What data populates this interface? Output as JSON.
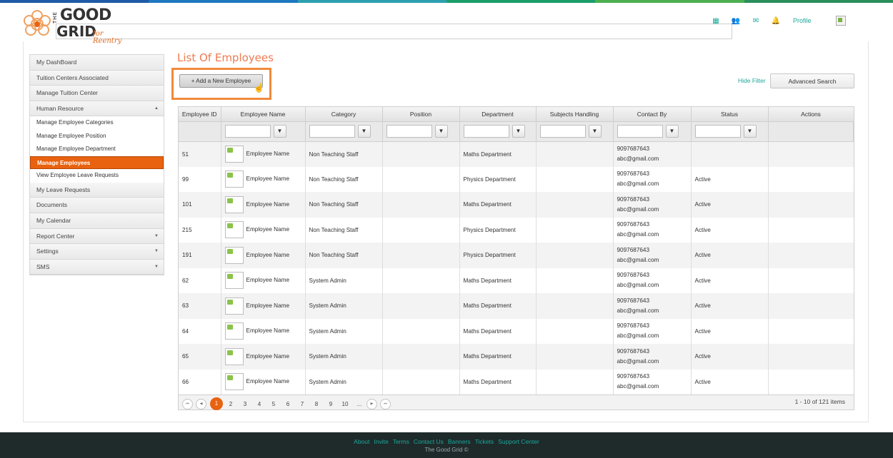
{
  "colors": {
    "accent_orange": "#e8620f",
    "title_orange": "#f07b50",
    "teal": "#1aa89a",
    "stripe": [
      "#1e5aa6",
      "#1e78c0",
      "#2d9fb0",
      "#1a9e6a",
      "#4caf50",
      "#2a8f5c"
    ]
  },
  "header": {
    "logo": {
      "the": "THE",
      "good": "GOOD",
      "grid": "GRID",
      "tagline": "for Reentry"
    },
    "nav": [
      {
        "name": "apps-icon",
        "glyph": "▦"
      },
      {
        "name": "users-icon",
        "glyph": "👥"
      },
      {
        "name": "mail-icon",
        "glyph": "✉"
      },
      {
        "name": "bell-icon",
        "glyph": "🔔"
      }
    ],
    "profile_label": "Profile"
  },
  "sidebar": {
    "items": [
      {
        "label": "My DashBoard"
      },
      {
        "label": "Tuition Centers Associated"
      },
      {
        "label": "Manage Tuition Center"
      },
      {
        "label": "Human Resource",
        "caret": "▲"
      }
    ],
    "subitems": [
      {
        "label": "Manage Employee Categories"
      },
      {
        "label": "Manage Employee Position"
      },
      {
        "label": "Manage Employee Department"
      },
      {
        "label": "Manage Employees"
      },
      {
        "label": "View Employee Leave Requests"
      }
    ],
    "items_after": [
      {
        "label": "My Leave Requests"
      },
      {
        "label": "Documents"
      },
      {
        "label": "My Calendar"
      },
      {
        "label": "Report Center",
        "caret": "▼"
      },
      {
        "label": "Settings",
        "caret": "▼"
      },
      {
        "label": "SMS",
        "caret": "▼"
      }
    ]
  },
  "main": {
    "title": "List Of Employees",
    "add_button": "+  Add a New Employee",
    "hide_filter": "Hide Filter",
    "advanced_search": "Advanced Search"
  },
  "grid": {
    "columns": [
      "Employee ID",
      "Employee Name",
      "Category",
      "Position",
      "Department",
      "Subjects Handling",
      "Contact By",
      "Status",
      "Actions"
    ],
    "filter_icon": "▼",
    "rows": [
      {
        "id": "51",
        "name": "Employee Name",
        "category": "Non Teaching Staff",
        "position": "",
        "department": "Maths Department",
        "subjects": "",
        "phone": "9097687643",
        "email": "abc@gmail.com",
        "status": ""
      },
      {
        "id": "99",
        "name": "Employee Name",
        "category": "Non Teaching Staff",
        "position": "",
        "department": "Physics Department",
        "subjects": "",
        "phone": "9097687643",
        "email": "abc@gmail.com",
        "status": "Active"
      },
      {
        "id": "101",
        "name": "Employee Name",
        "category": "Non Teaching Staff",
        "position": "",
        "department": "Maths Department",
        "subjects": "",
        "phone": "9097687643",
        "email": "abc@gmail.com",
        "status": "Active"
      },
      {
        "id": "215",
        "name": "Employee Name",
        "category": "Non Teaching Staff",
        "position": "",
        "department": "Physics Department",
        "subjects": "",
        "phone": "9097687643",
        "email": "abc@gmail.com",
        "status": "Active"
      },
      {
        "id": "191",
        "name": "Employee Name",
        "category": "Non Teaching Staff",
        "position": "",
        "department": "Physics Department",
        "subjects": "",
        "phone": "9097687643",
        "email": "abc@gmail.com",
        "status": "Active"
      },
      {
        "id": "62",
        "name": "Employee Name",
        "category": "System Admin",
        "position": "",
        "department": "Maths Department",
        "subjects": "",
        "phone": "9097687643",
        "email": "abc@gmail.com",
        "status": "Active"
      },
      {
        "id": "63",
        "name": "Employee Name",
        "category": "System Admin",
        "position": "",
        "department": "Maths Department",
        "subjects": "",
        "phone": "9097687643",
        "email": "abc@gmail.com",
        "status": "Active"
      },
      {
        "id": "64",
        "name": "Employee Name",
        "category": "System Admin",
        "position": "",
        "department": "Maths Department",
        "subjects": "",
        "phone": "9097687643",
        "email": "abc@gmail.com",
        "status": "Active"
      },
      {
        "id": "65",
        "name": "Employee Name",
        "category": "System Admin",
        "position": "",
        "department": "Maths Department",
        "subjects": "",
        "phone": "9097687643",
        "email": "abc@gmail.com",
        "status": "Active"
      },
      {
        "id": "66",
        "name": "Employee Name",
        "category": "System Admin",
        "position": "",
        "department": "Maths Department",
        "subjects": "",
        "phone": "9097687643",
        "email": "abc@gmail.com",
        "status": "Active"
      }
    ]
  },
  "pager": {
    "pages": [
      "1",
      "2",
      "3",
      "4",
      "5",
      "6",
      "7",
      "8",
      "9",
      "10",
      "..."
    ],
    "current": "1",
    "first": "⏮",
    "prev": "◀",
    "next": "▶",
    "last": "⏭",
    "info": "1 - 10 of 121 items"
  },
  "footer": {
    "links": [
      "About",
      "Invite",
      "Terms",
      "Contact Us",
      "Banners",
      "Tickets",
      "Support Center"
    ],
    "copyright": "The Good Grid ©"
  }
}
